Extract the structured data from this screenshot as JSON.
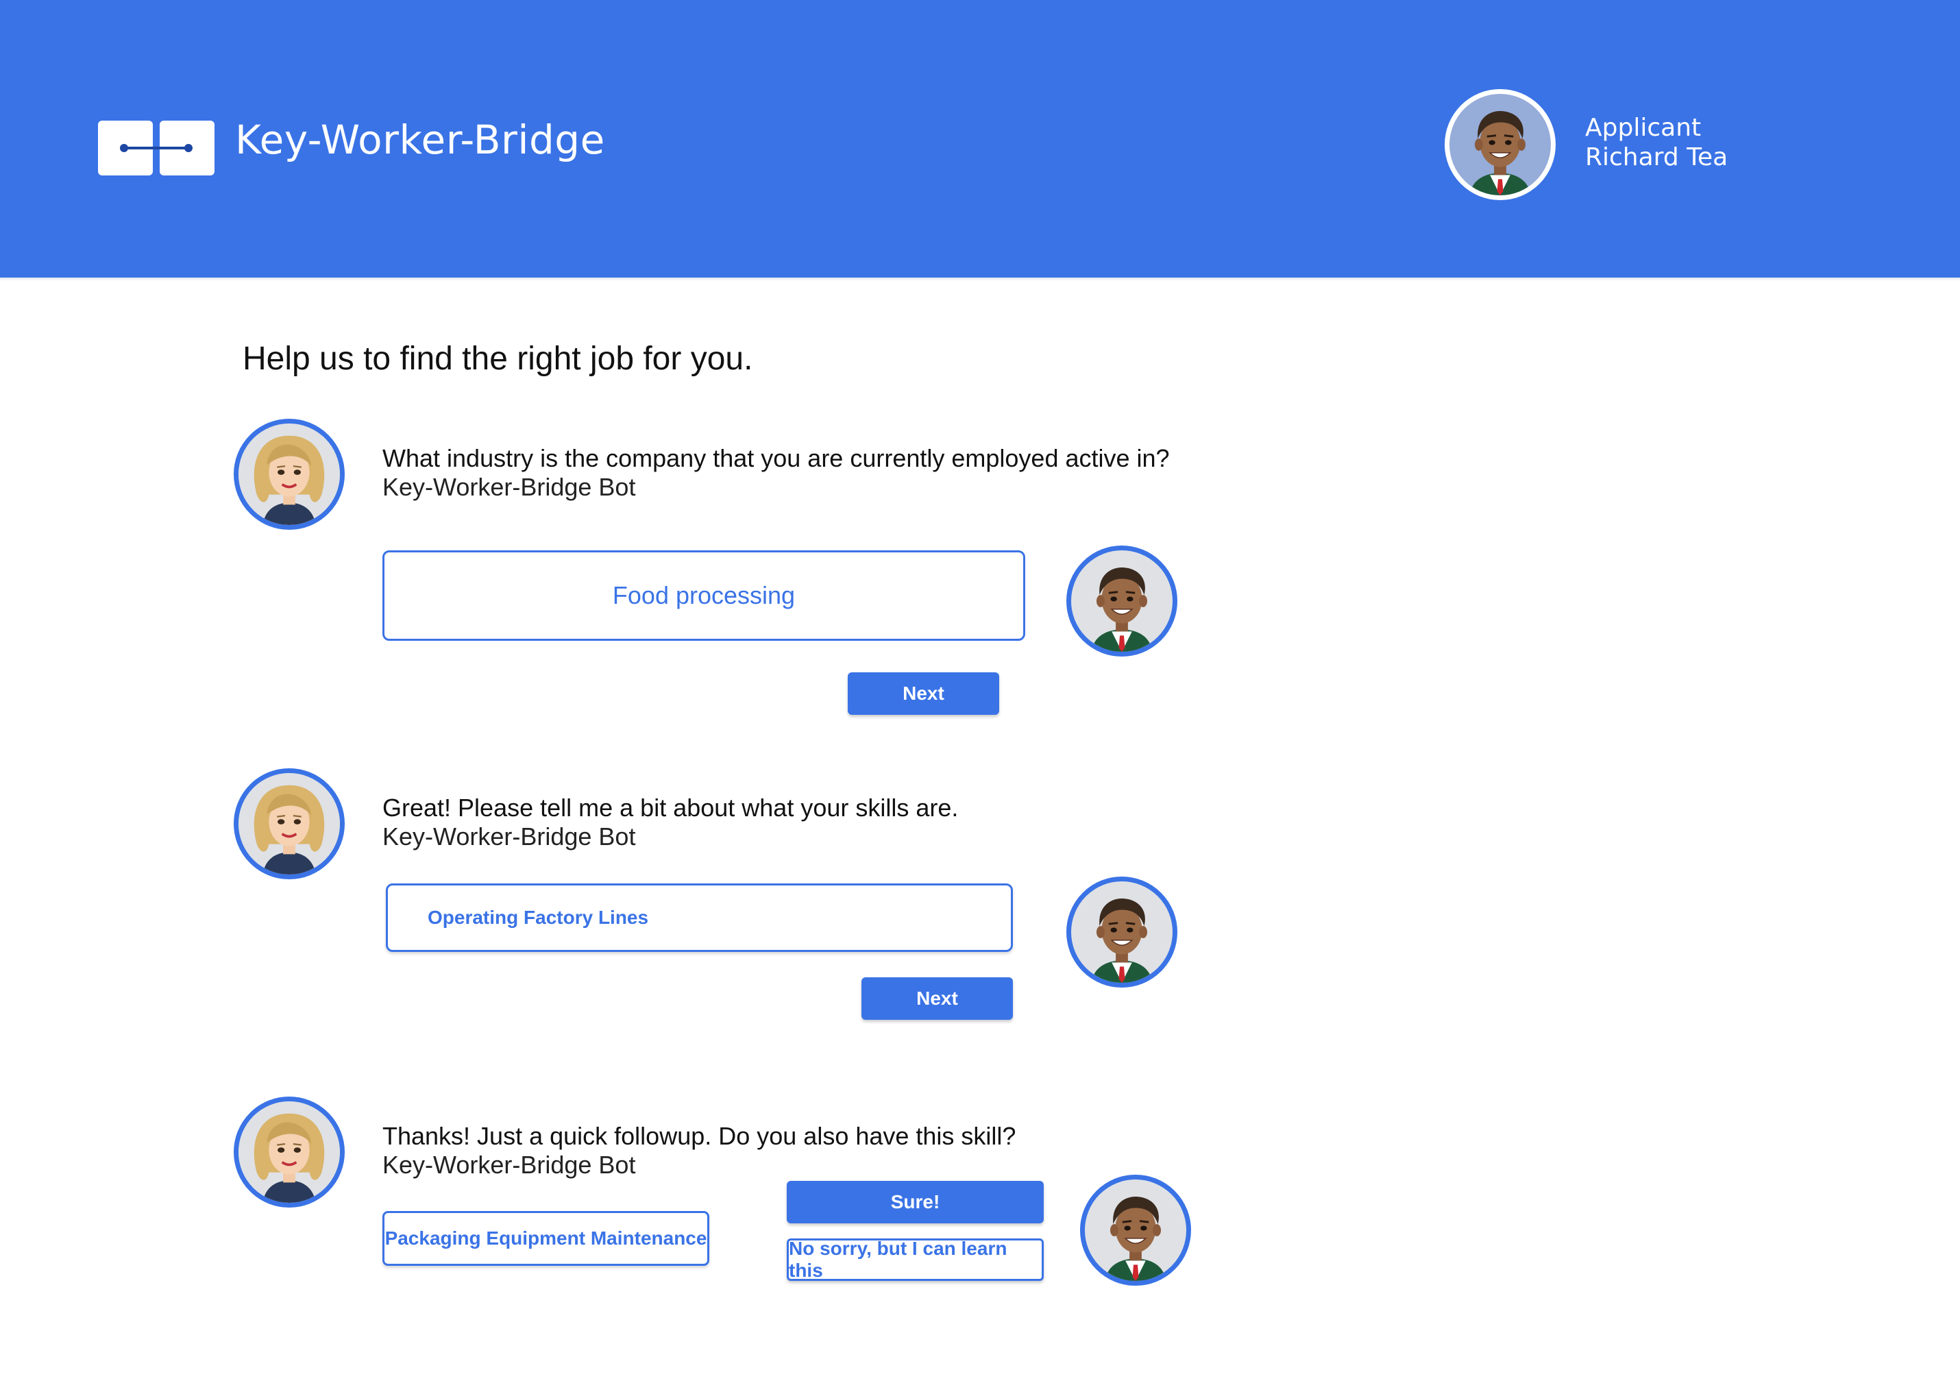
{
  "header": {
    "app_title": "Key-Worker-Bridge",
    "user_role": "Applicant",
    "user_name": "Richard Tea"
  },
  "page": {
    "title": "Help us to find the right job for you."
  },
  "colors": {
    "brand_blue": "#3a73e6",
    "logo_line": "#1d47a3",
    "bg": "#ffffff"
  },
  "conversation": [
    {
      "question": "What industry is the company that you are currently employed active in?",
      "sender": "Key-Worker-Bridge Bot",
      "answer_value": "Food processing",
      "next_label": "Next"
    },
    {
      "question": "Great! Please tell me a bit about what your skills are.",
      "sender": "Key-Worker-Bridge Bot",
      "answer_value": "Operating Factory Lines",
      "next_label": "Next"
    },
    {
      "question": "Thanks! Just a quick followup. Do you also have this skill?",
      "sender": "Key-Worker-Bridge Bot",
      "skill_chip": "Packaging Equipment Maintenance",
      "yes_label": "Sure!",
      "no_label": "No sorry, but I can learn this"
    }
  ]
}
